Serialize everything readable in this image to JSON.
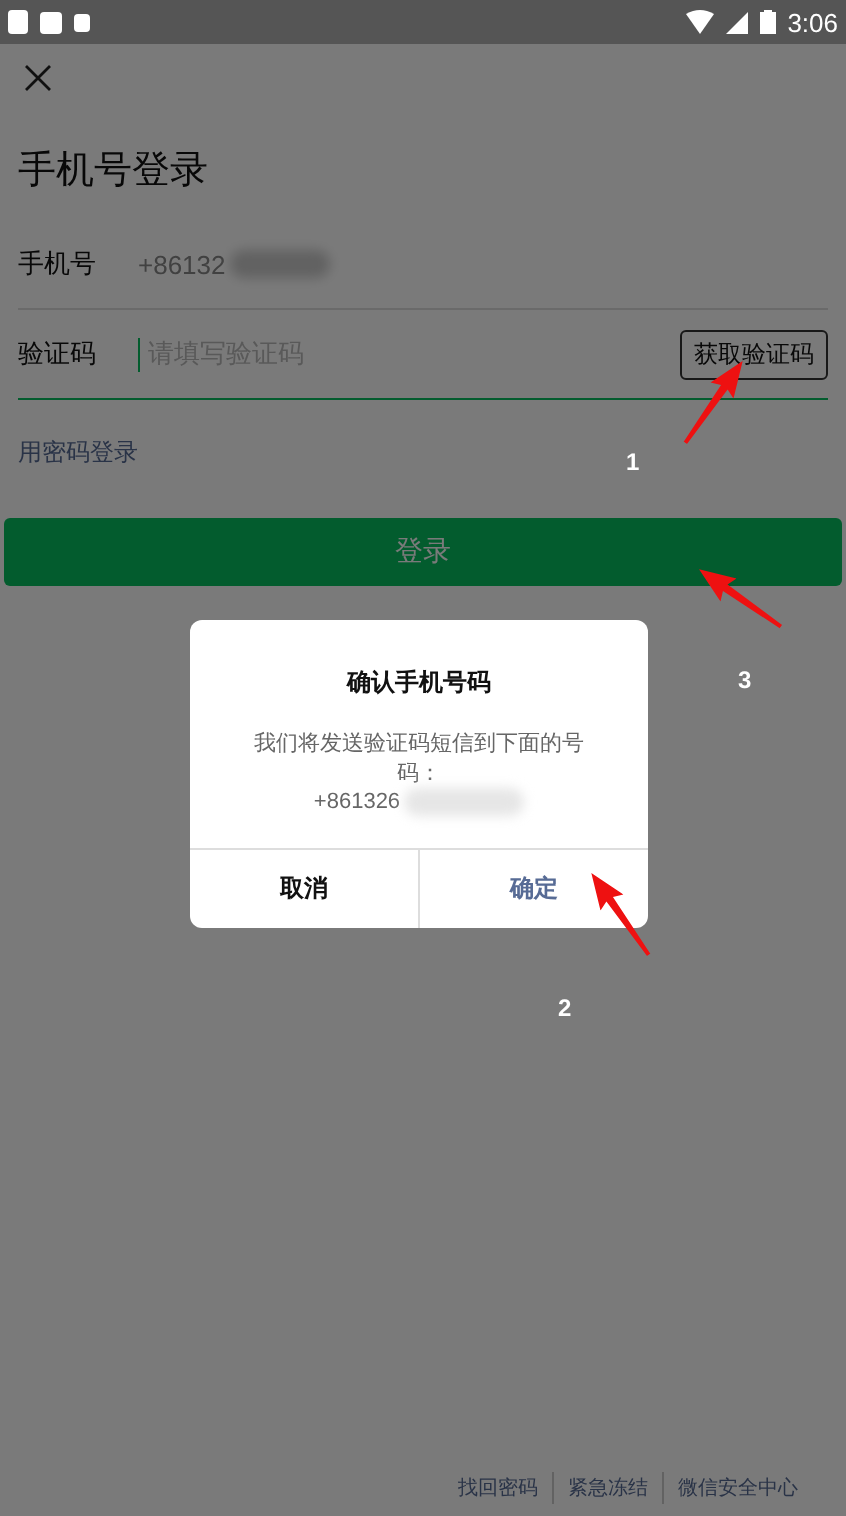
{
  "status_bar": {
    "time": "3:06"
  },
  "title": "手机号登录",
  "phone": {
    "label": "手机号",
    "value": "+86132",
    "redacted": true
  },
  "code": {
    "label": "验证码",
    "placeholder": "请填写验证码",
    "button": "获取验证码"
  },
  "password_link": "用密码登录",
  "login_button": "登录",
  "dialog": {
    "title": "确认手机号码",
    "message": "我们将发送验证码短信到下面的号码：",
    "number": "+861326",
    "number_redacted": true,
    "buttons": [
      {
        "label": "取消",
        "primary": false
      },
      {
        "label": "确定",
        "primary": true
      }
    ]
  },
  "footer_links": [
    "找回密码",
    "紧急冻结",
    "微信安全中心"
  ],
  "annotations": [
    {
      "label": "1"
    },
    {
      "label": "2"
    },
    {
      "label": "3"
    }
  ]
}
